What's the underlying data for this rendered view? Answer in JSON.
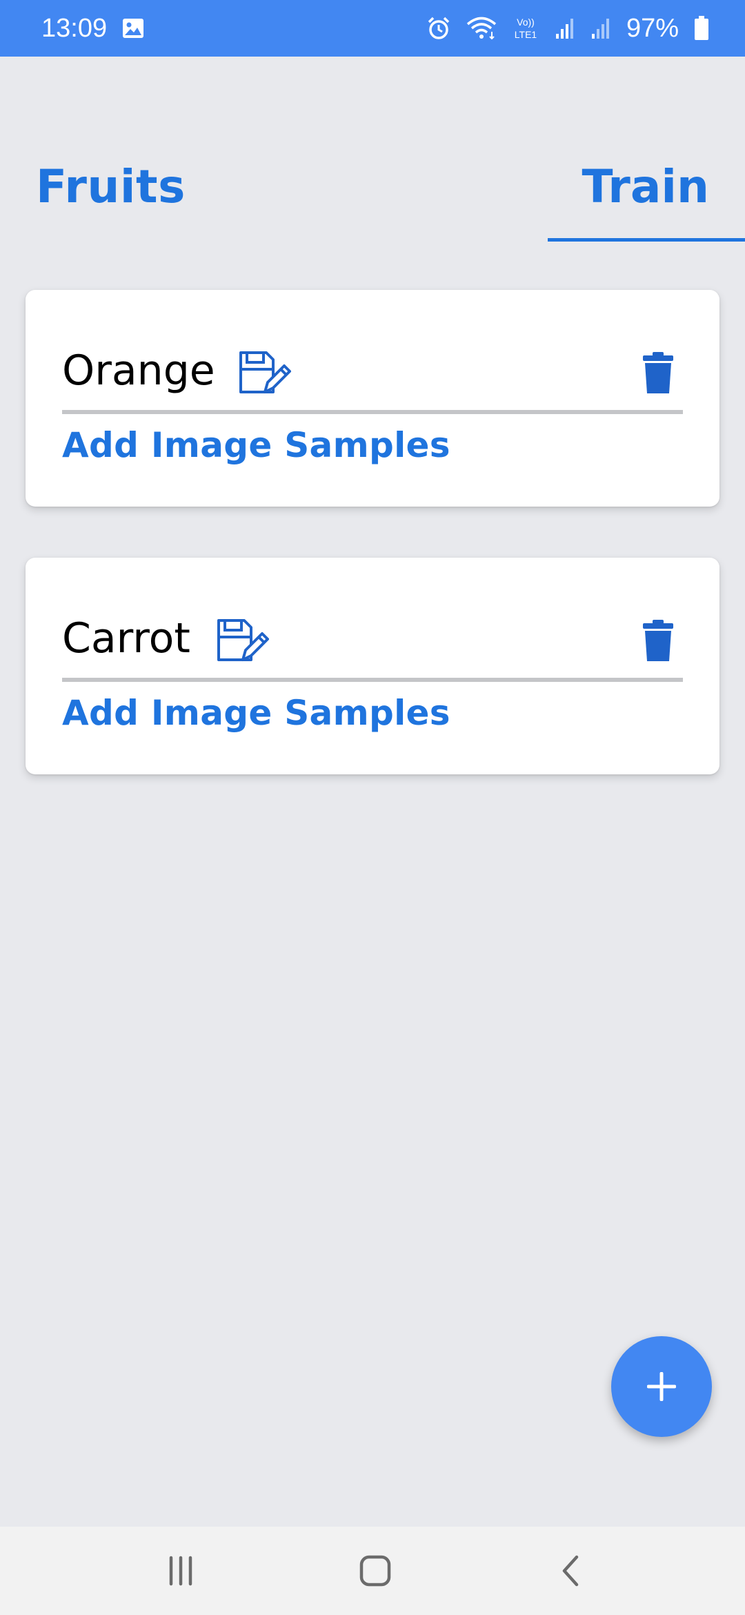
{
  "status_bar": {
    "time": "13:09",
    "battery": "97%",
    "icons": [
      "gallery-icon",
      "alarm-icon",
      "wifi-icon",
      "volte-icon",
      "signal-icon",
      "signal-icon",
      "battery-icon"
    ]
  },
  "header": {
    "title": "Fruits",
    "tab_label": "Train"
  },
  "cards": [
    {
      "name": "Orange",
      "action_label": "Add Image Samples"
    },
    {
      "name": "Carrot",
      "action_label": "Add Image Samples"
    }
  ],
  "fab": {
    "icon": "plus-icon"
  },
  "nav": {
    "icons": [
      "recents-icon",
      "home-icon",
      "back-icon"
    ]
  },
  "colors": {
    "accent": "#1f74de",
    "status_bar": "#4287f2",
    "background": "#e8e9ed",
    "card": "#ffffff"
  }
}
